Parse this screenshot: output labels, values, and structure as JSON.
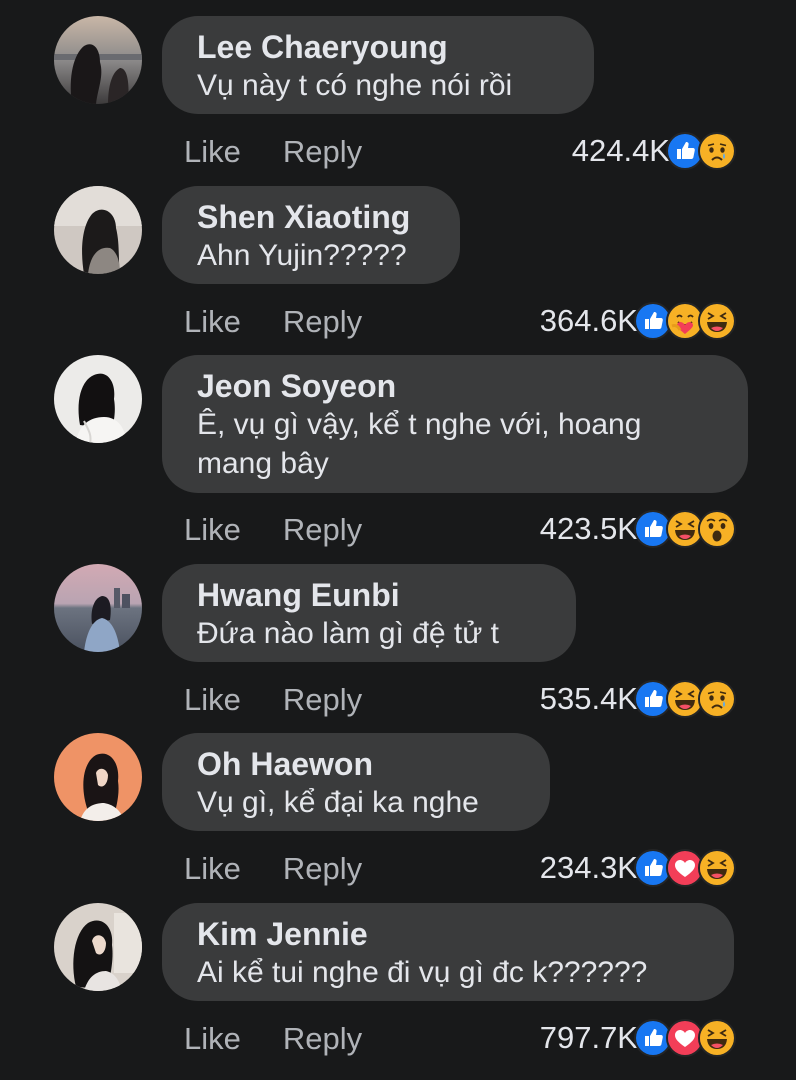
{
  "colors": {
    "background": "#18191a",
    "bubble": "#3a3b3c",
    "like_blue": "#1877f2",
    "love_red": "#f33e58",
    "emoji_yellow": "#f7b125",
    "muted_text": "#b0b3b8"
  },
  "actions": {
    "like_label": "Like",
    "reply_label": "Reply"
  },
  "comments": [
    {
      "author": "Lee Chaeryoung",
      "text": "Vụ này t có nghe nói rồi",
      "reaction_count": "424.4K",
      "reactions": [
        "like-icon",
        "sad-icon"
      ]
    },
    {
      "author": "Shen Xiaoting",
      "text": "Ahn Yujin?????",
      "reaction_count": "364.6K",
      "reactions": [
        "like-icon",
        "care-icon",
        "haha-icon"
      ]
    },
    {
      "author": "Jeon Soyeon",
      "text": "Ê, vụ gì vậy, kể t nghe với, hoang mang bây",
      "reaction_count": "423.5K",
      "reactions": [
        "like-icon",
        "haha-icon",
        "wow-icon"
      ]
    },
    {
      "author": "Hwang Eunbi",
      "text": "Đứa nào làm gì đệ tử t",
      "reaction_count": "535.4K",
      "reactions": [
        "like-icon",
        "haha-icon",
        "sad-icon"
      ]
    },
    {
      "author": "Oh Haewon",
      "text": "Vụ gì, kể đại ka nghe",
      "reaction_count": "234.3K",
      "reactions": [
        "like-icon",
        "love-icon",
        "haha-icon"
      ]
    },
    {
      "author": "Kim Jennie",
      "text": "Ai kể tui nghe đi vụ gì đc k??????",
      "reaction_count": "797.7K",
      "reactions": [
        "like-icon",
        "love-icon",
        "haha-icon"
      ]
    }
  ]
}
